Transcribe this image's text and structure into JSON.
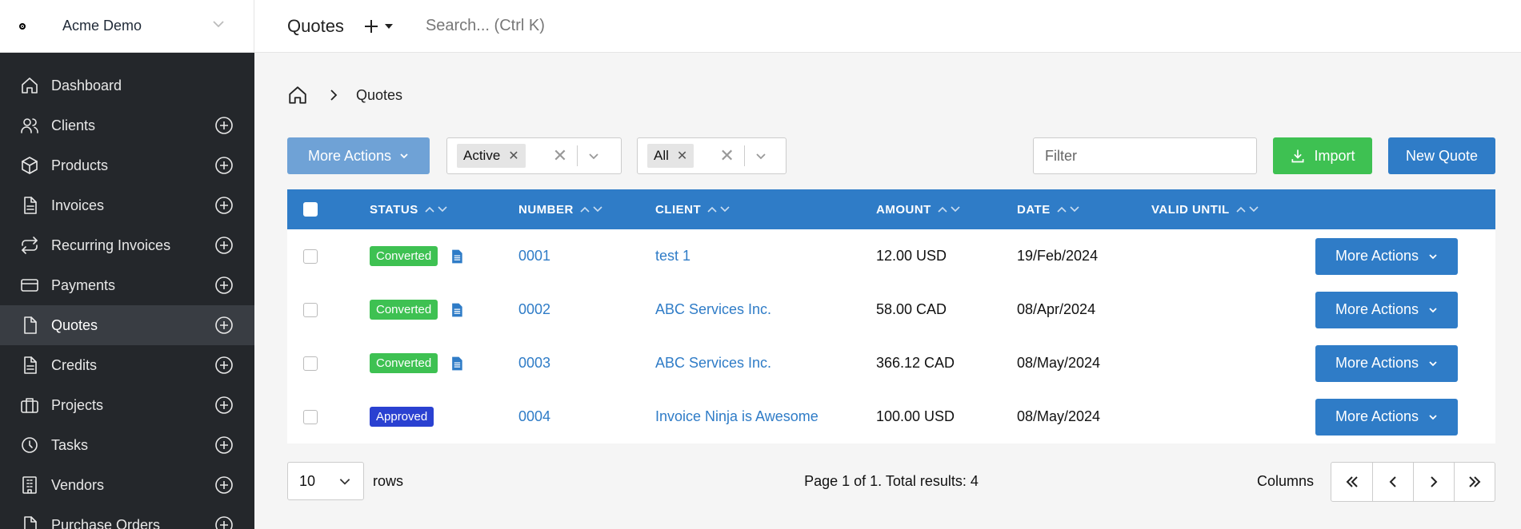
{
  "app": {
    "company": "Acme Demo"
  },
  "sidebar": {
    "items": [
      {
        "label": "Dashboard",
        "icon": "home-icon",
        "has_add": false,
        "active": false
      },
      {
        "label": "Clients",
        "icon": "users-icon",
        "has_add": true,
        "active": false
      },
      {
        "label": "Products",
        "icon": "box-icon",
        "has_add": true,
        "active": false
      },
      {
        "label": "Invoices",
        "icon": "file-text-icon",
        "has_add": true,
        "active": false
      },
      {
        "label": "Recurring Invoices",
        "icon": "repeat-icon",
        "has_add": true,
        "active": false
      },
      {
        "label": "Payments",
        "icon": "credit-card-icon",
        "has_add": true,
        "active": false
      },
      {
        "label": "Quotes",
        "icon": "file-icon",
        "has_add": true,
        "active": true
      },
      {
        "label": "Credits",
        "icon": "file-text-icon",
        "has_add": true,
        "active": false
      },
      {
        "label": "Projects",
        "icon": "briefcase-icon",
        "has_add": true,
        "active": false
      },
      {
        "label": "Tasks",
        "icon": "clock-icon",
        "has_add": true,
        "active": false
      },
      {
        "label": "Vendors",
        "icon": "building-icon",
        "has_add": true,
        "active": false
      },
      {
        "label": "Purchase Orders",
        "icon": "file-icon",
        "has_add": true,
        "active": false
      }
    ]
  },
  "header": {
    "title": "Quotes",
    "search_placeholder": "Search... (Ctrl K)"
  },
  "breadcrumb": {
    "current": "Quotes"
  },
  "toolbar": {
    "more_actions": "More Actions",
    "status_filter": "Active",
    "client_filter": "All",
    "filter_placeholder": "Filter",
    "import_label": "Import",
    "new_label": "New Quote"
  },
  "table": {
    "headers": {
      "status": "STATUS",
      "number": "NUMBER",
      "client": "CLIENT",
      "amount": "AMOUNT",
      "date": "DATE",
      "valid_until": "VALID UNTIL"
    },
    "rows": [
      {
        "status": "Converted",
        "number": "0001",
        "client": "test 1",
        "amount": "12.00 USD",
        "date": "19/Feb/2024",
        "valid_until": "",
        "has_doc": true,
        "action": "More Actions"
      },
      {
        "status": "Converted",
        "number": "0002",
        "client": "ABC Services Inc.",
        "amount": "58.00 CAD",
        "date": "08/Apr/2024",
        "valid_until": "",
        "has_doc": true,
        "action": "More Actions"
      },
      {
        "status": "Converted",
        "number": "0003",
        "client": "ABC Services Inc.",
        "amount": "366.12 CAD",
        "date": "08/May/2024",
        "valid_until": "",
        "has_doc": true,
        "action": "More Actions"
      },
      {
        "status": "Approved",
        "number": "0004",
        "client": "Invoice Ninja is Awesome",
        "amount": "100.00 USD",
        "date": "08/May/2024",
        "valid_until": "",
        "has_doc": false,
        "action": "More Actions"
      }
    ]
  },
  "footer": {
    "per_page": "10",
    "rows_label": "rows",
    "page_info": "Page 1 of 1. Total results: 4",
    "columns_label": "Columns"
  },
  "colors": {
    "primary": "#2f7cc7",
    "converted": "#3ec152",
    "approved": "#2a41d1",
    "sidebar": "#24272b"
  }
}
